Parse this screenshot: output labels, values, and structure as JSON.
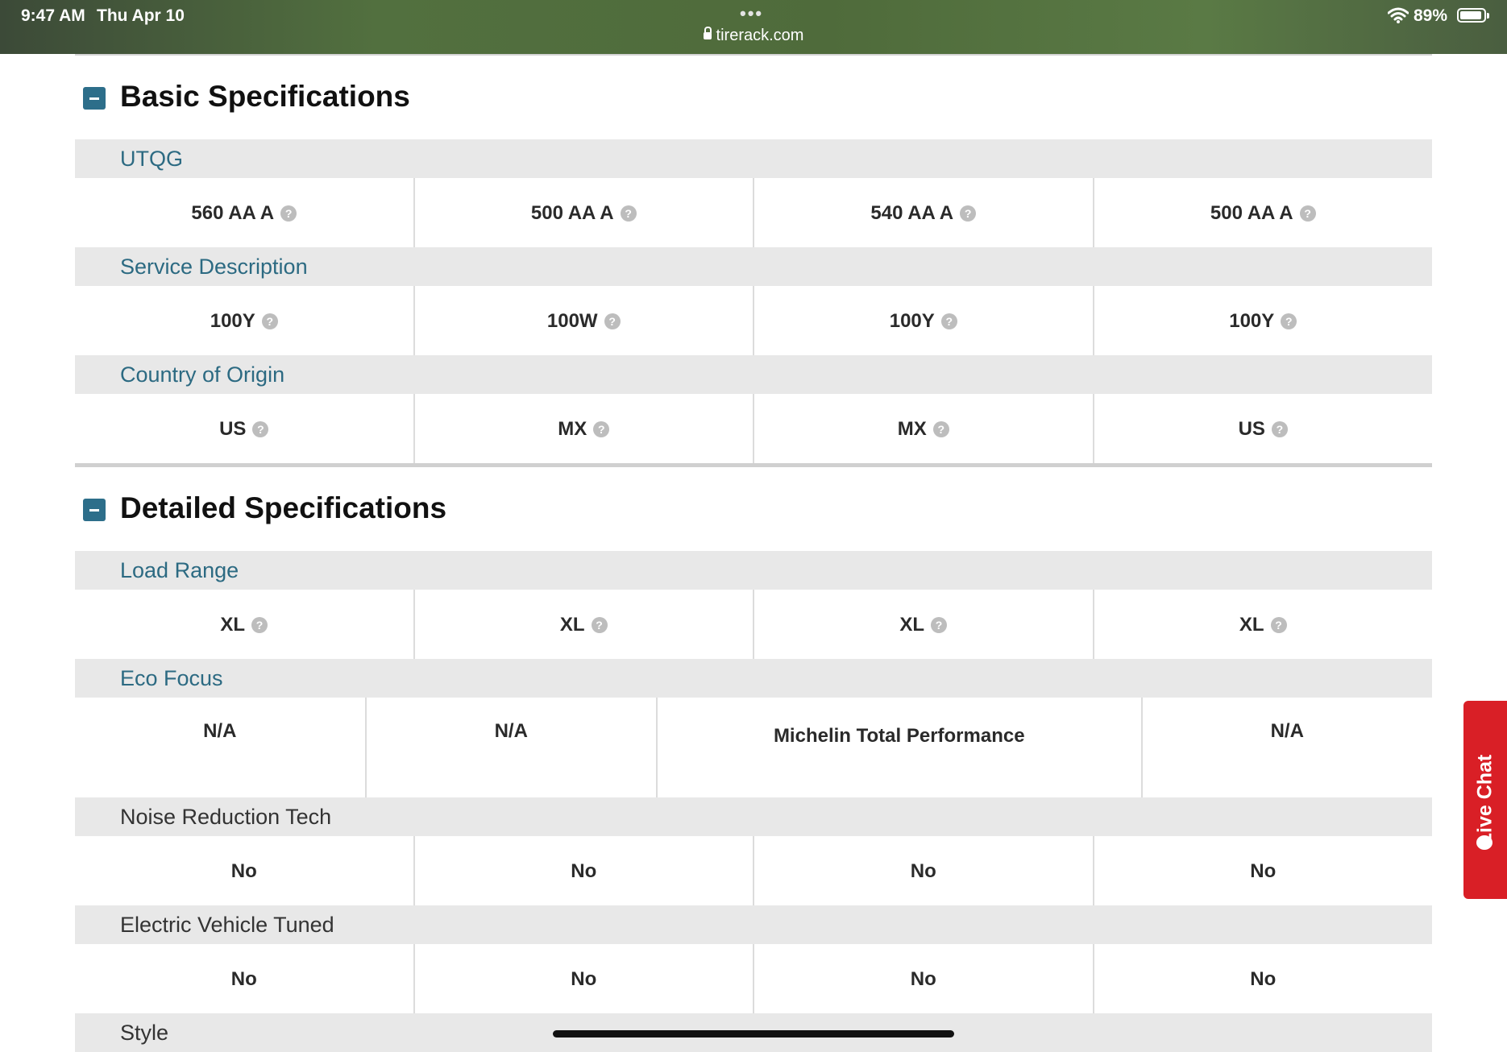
{
  "status_bar": {
    "time": "9:47 AM",
    "date": "Thu Apr 10",
    "dots": "•••",
    "url": "tirerack.com",
    "battery": "89%",
    "battery_level": 0.89
  },
  "sections": {
    "basic": {
      "title": "Basic Specifications",
      "rows": {
        "utqg": {
          "label": "UTQG",
          "values": [
            "560 AA A",
            "500 AA A",
            "540 AA A",
            "500 AA A"
          ]
        },
        "service": {
          "label": "Service Description",
          "values": [
            "100Y",
            "100W",
            "100Y",
            "100Y"
          ]
        },
        "origin": {
          "label": "Country of Origin",
          "values": [
            "US",
            "MX",
            "MX",
            "US"
          ]
        }
      }
    },
    "detailed": {
      "title": "Detailed Specifications",
      "rows": {
        "load": {
          "label": "Load Range",
          "values": [
            "XL",
            "XL",
            "XL",
            "XL"
          ]
        },
        "eco": {
          "label": "Eco Focus",
          "values": [
            "N/A",
            "N/A",
            "Michelin Total Performance",
            "N/A"
          ]
        },
        "noise": {
          "label": "Noise Reduction Tech",
          "values": [
            "No",
            "No",
            "No",
            "No"
          ]
        },
        "ev": {
          "label": "Electric Vehicle Tuned",
          "values": [
            "No",
            "No",
            "No",
            "No"
          ]
        },
        "style": {
          "label": "Style"
        }
      }
    }
  },
  "help_glyph": "?",
  "live_chat": {
    "label": "Live Chat"
  },
  "colors": {
    "accent": "#2d6e8a",
    "label_text": "#2c6a82",
    "live_chat": "#d91f26"
  }
}
